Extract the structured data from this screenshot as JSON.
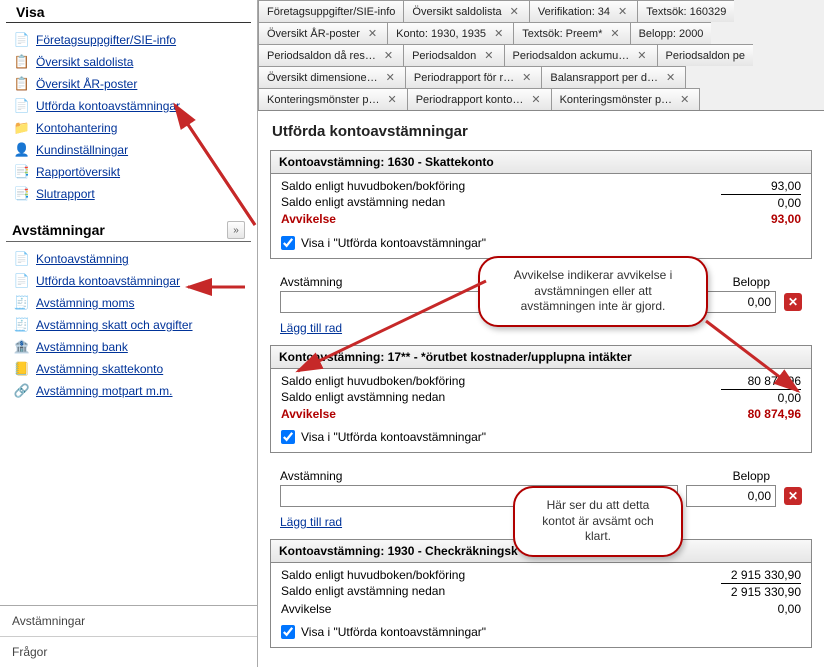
{
  "sidebar": {
    "sections": {
      "visa": {
        "title": "Visa",
        "items": [
          "Företagsuppgifter/SIE-info",
          "Översikt saldolista",
          "Översikt ÅR-poster",
          "Utförda kontoavstämningar",
          "Kontohantering",
          "Kundinställningar",
          "Rapportöversikt",
          "Slutrapport"
        ]
      },
      "avstamningar": {
        "title": "Avstämningar",
        "items": [
          "Kontoavstämning",
          "Utförda kontoavstämningar",
          "Avstämning moms",
          "Avstämning skatt och avgifter",
          "Avstämning bank",
          "Avstämning skattekonto",
          "Avstämning motpart m.m."
        ]
      }
    },
    "bottom": [
      "Avstämningar",
      "Frågor"
    ]
  },
  "tabs": {
    "rows": [
      [
        {
          "label": "Företagsuppgifter/SIE-info"
        },
        {
          "label": "Översikt saldolista",
          "close": true
        },
        {
          "label": "Verifikation: 34",
          "close": true
        },
        {
          "label": "Textsök: 160329",
          "close": false
        }
      ],
      [
        {
          "label": "Översikt ÅR-poster",
          "close": true
        },
        {
          "label": "Konto: 1930, 1935",
          "close": true
        },
        {
          "label": "Textsök: Preem*",
          "close": true
        },
        {
          "label": "Belopp: 2000",
          "close": false
        }
      ],
      [
        {
          "label": "Periodsaldon då res…",
          "close": true
        },
        {
          "label": "Periodsaldon",
          "close": true
        },
        {
          "label": "Periodsaldon ackumu…",
          "close": true
        },
        {
          "label": "Periodsaldon pe",
          "close": false
        }
      ],
      [
        {
          "label": "Översikt dimensione…",
          "close": true
        },
        {
          "label": "Periodrapport för r…",
          "close": true
        },
        {
          "label": "Balansrapport per d…",
          "close": true
        }
      ],
      [
        {
          "label": "Konteringsmönster p…",
          "close": true
        },
        {
          "label": "Periodrapport konto…",
          "close": true
        },
        {
          "label": "Konteringsmönster p…",
          "close": true
        }
      ]
    ]
  },
  "page": {
    "title": "Utförda kontoavstämningar",
    "row_labels": {
      "saldo_hb": "Saldo enligt huvudboken/bokföring",
      "saldo_avst": "Saldo enligt avstämning nedan",
      "avvikelse": "Avvikelse"
    },
    "show_label": "Visa i \"Utförda kontoavstämningar\"",
    "avst_col_label": "Avstämning",
    "belopp_col_label": "Belopp",
    "add_row_label": "Lägg till rad",
    "sections": [
      {
        "header": "Kontoavstämning: 1630 - Skattekonto",
        "saldo_hb": "93,00",
        "saldo_avst": "0,00",
        "avvikelse": "93,00",
        "show_checked": true,
        "avst_value": "0,00"
      },
      {
        "header": "Kontoavstämning: 17** - *örutbet kostnader/upplupna intäkter",
        "saldo_hb": "80 874,96",
        "saldo_avst": "0,00",
        "avvikelse": "80 874,96",
        "show_checked": true,
        "avst_value": "0,00"
      },
      {
        "header": "Kontoavstämning: 1930 - Checkräkningsk",
        "saldo_hb": "2 915 330,90",
        "saldo_avst": "2 915 330,90",
        "avvikelse": "0,00",
        "show_checked": true
      }
    ],
    "callouts": {
      "c1": "Avvikelse indikerar avvikelse i avstämningen eller att avstämningen inte är gjord.",
      "c2": "Här ser du att detta kontot är avsämt och klart."
    }
  }
}
